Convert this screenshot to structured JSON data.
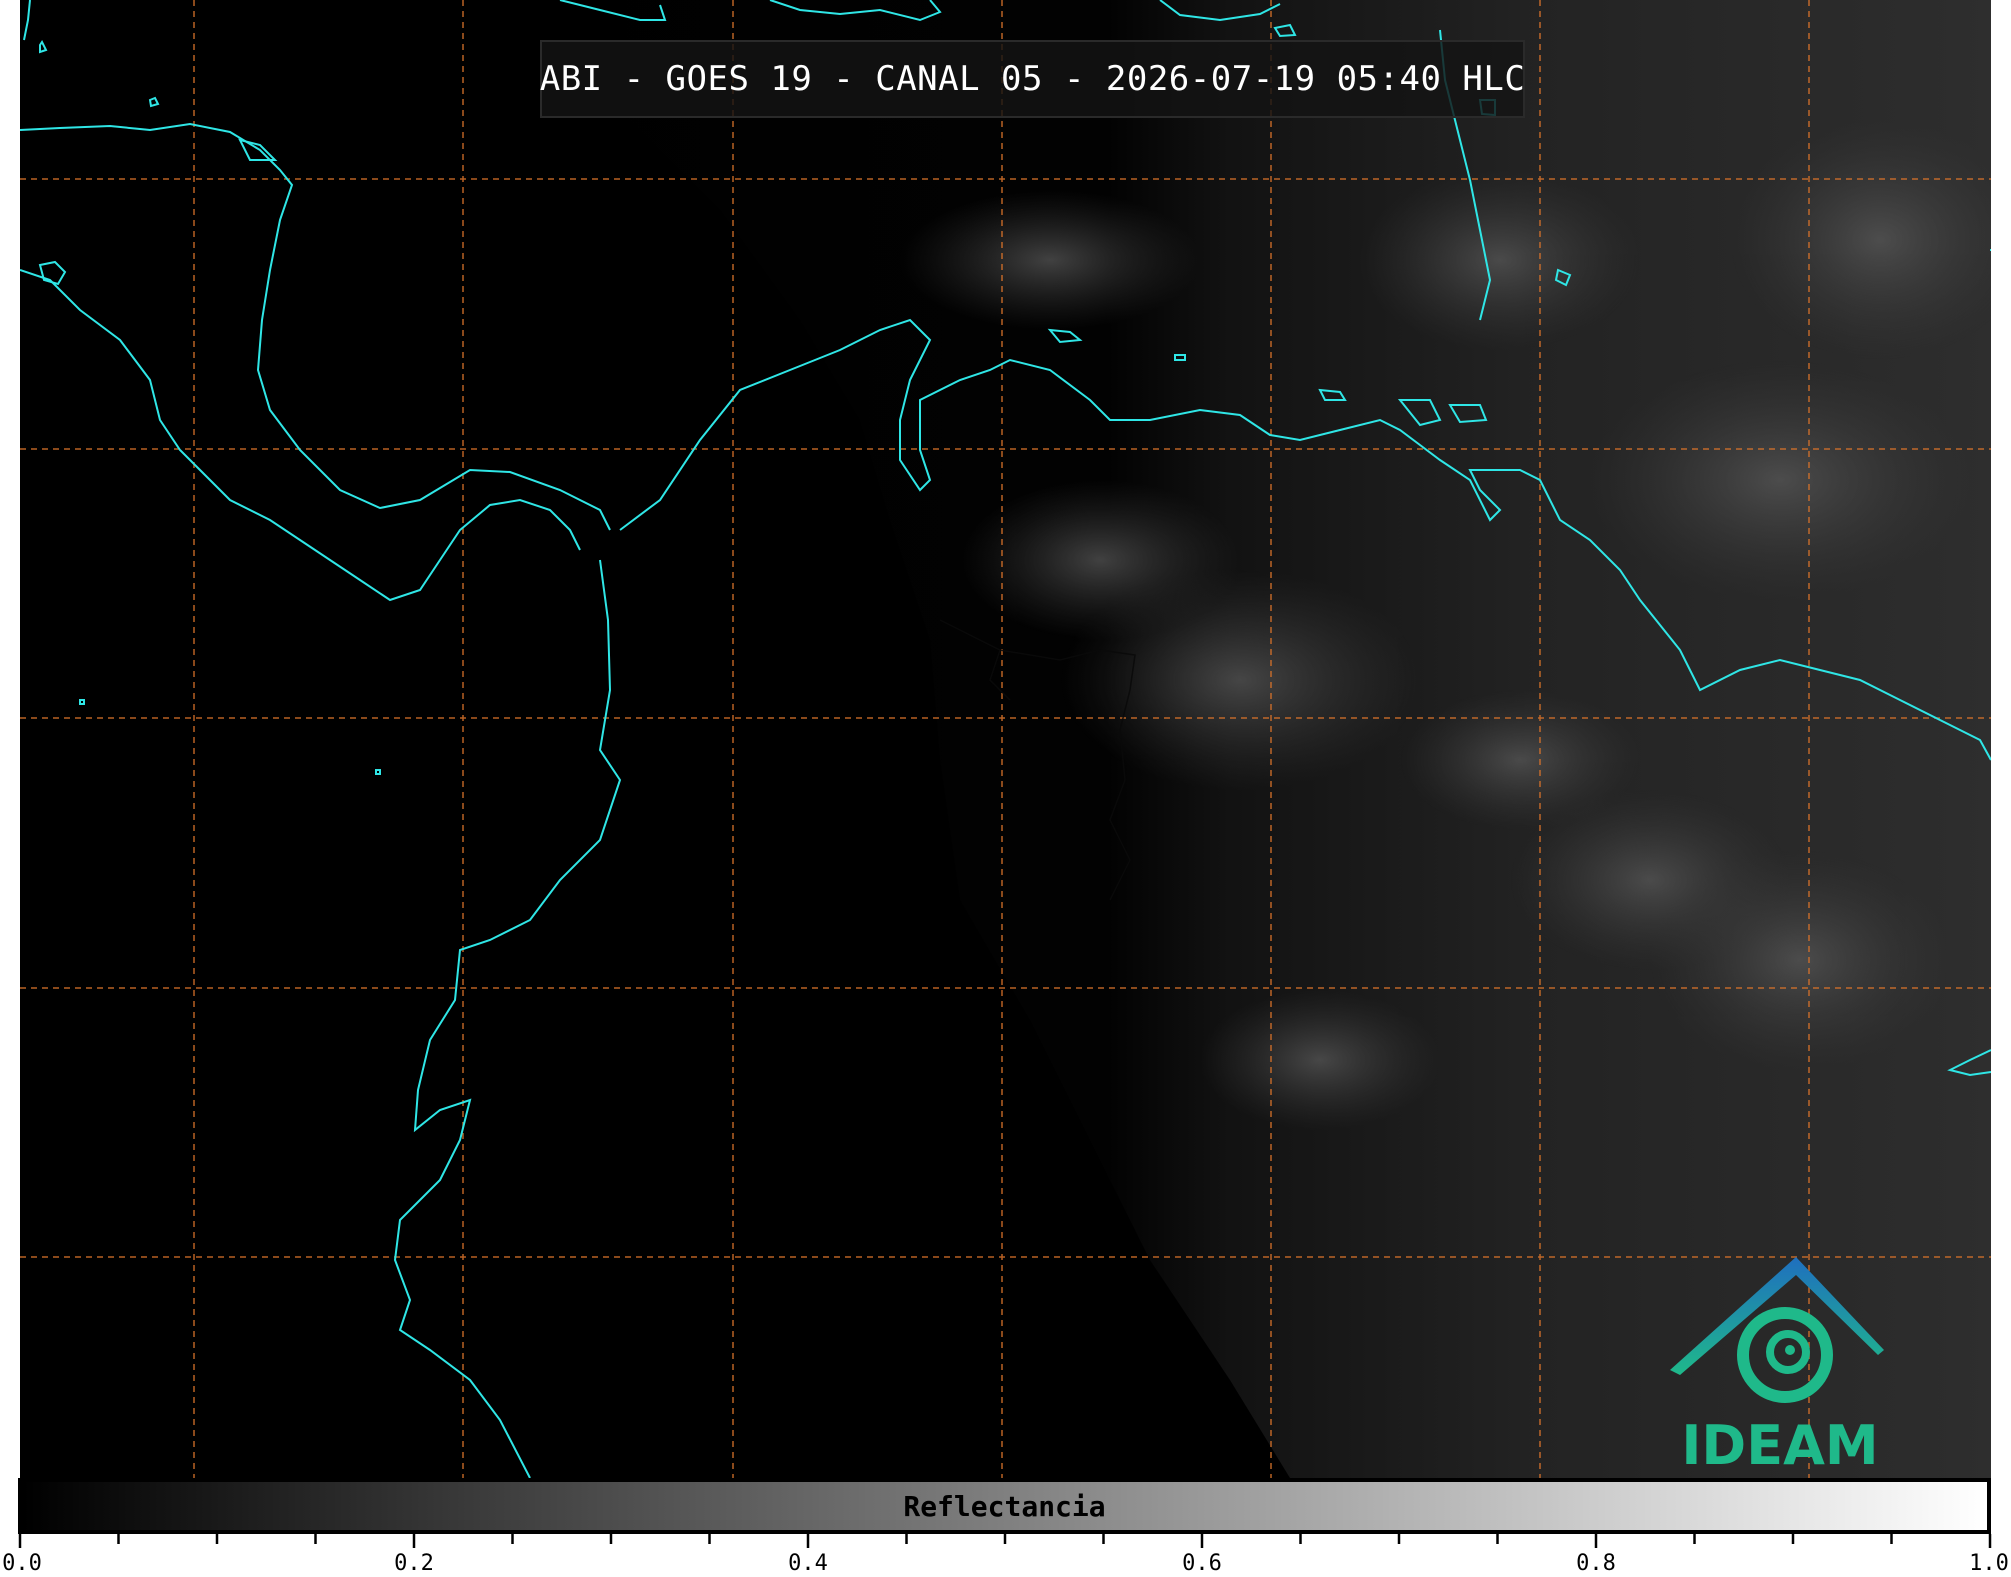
{
  "title": "ABI - GOES 19 - CANAL 05 - 2026-07-19 05:40 HLC",
  "colorbar": {
    "label": "Reflectancia",
    "min": 0.0,
    "max": 1.0,
    "tick_labels": [
      "0.0",
      "0.2",
      "0.4",
      "0.6",
      "0.8",
      "1.0"
    ],
    "colormap": "grayscale (black to white)"
  },
  "logo": {
    "text": "IDEAM"
  },
  "colors": {
    "coastline": "#2fe6e6",
    "gridlines": "#d9732a",
    "logo_teal": "#1fb98a",
    "logo_blue": "#1f6fbf"
  },
  "map": {
    "gridlines": "dashed orange lat/lon grid",
    "region": "Central America, Colombia, Venezuela and Caribbean"
  }
}
